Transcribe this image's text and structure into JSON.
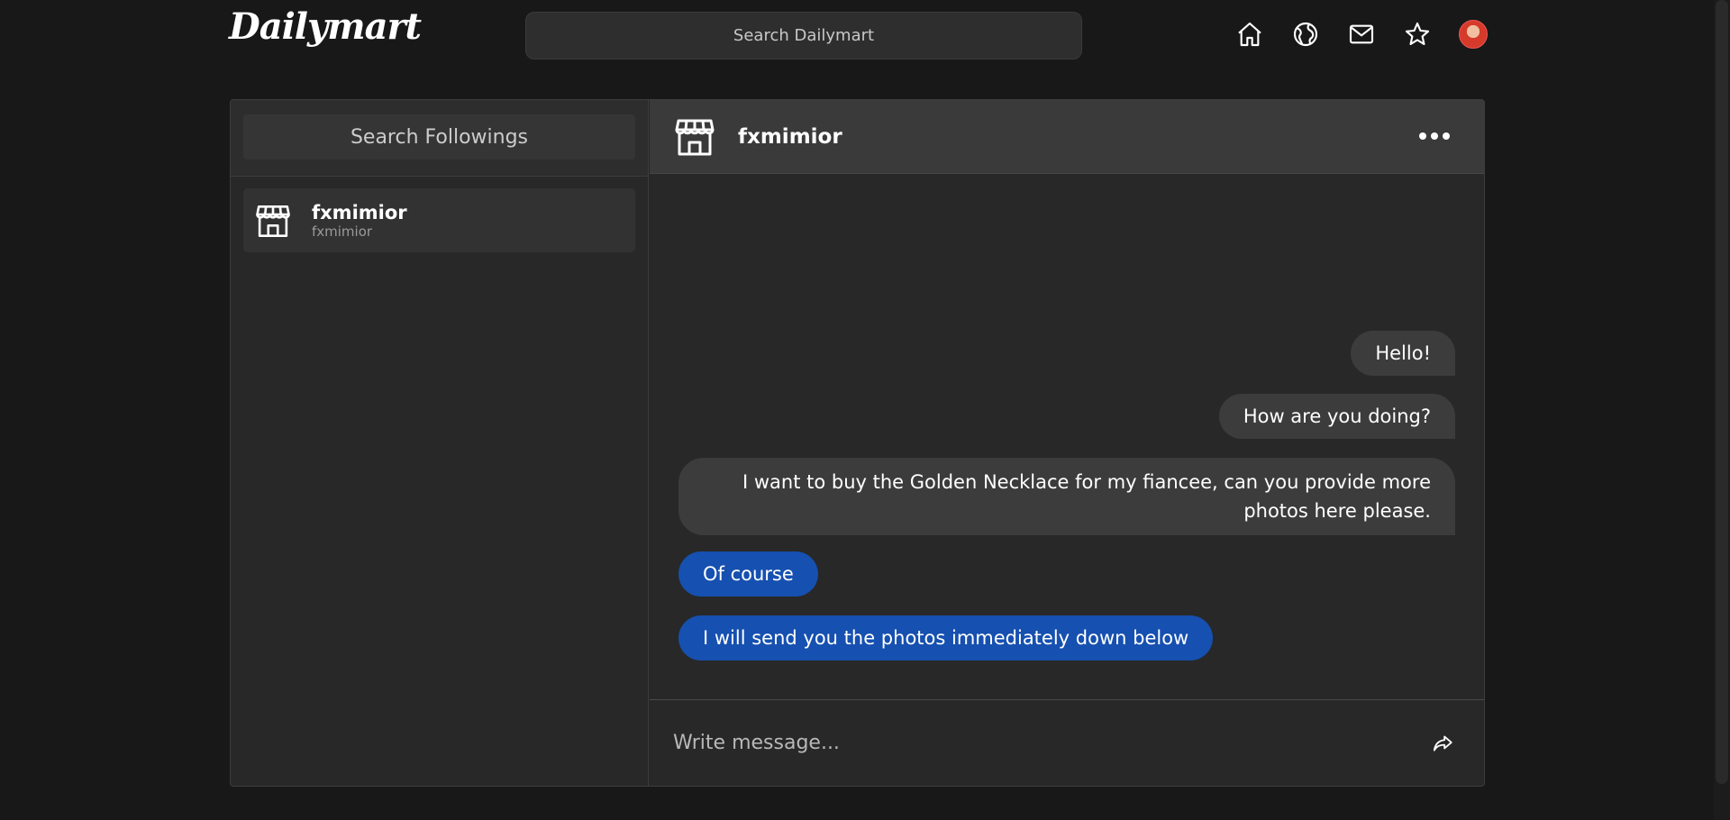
{
  "header": {
    "logo": "Dailymart",
    "search_placeholder": "Search Dailymart",
    "nav": [
      {
        "name": "home-icon"
      },
      {
        "name": "globe-icon"
      },
      {
        "name": "mail-icon"
      },
      {
        "name": "star-icon"
      },
      {
        "name": "avatar"
      }
    ]
  },
  "sidebar": {
    "search_placeholder": "Search Followings",
    "contacts": [
      {
        "name": "fxmimior",
        "handle": "fxmimior",
        "icon": "store-icon"
      }
    ]
  },
  "chat": {
    "title": "fxmimior",
    "icon": "store-icon",
    "more_icon": "more-horizontal-icon",
    "messages": [
      {
        "text": "Hello!",
        "direction": "outgoing"
      },
      {
        "text": "How are you doing?",
        "direction": "outgoing"
      },
      {
        "text": "I want to buy the Golden Necklace for my fiancee, can you provide more photos here please.",
        "direction": "outgoing"
      },
      {
        "text": "Of course",
        "direction": "incoming"
      },
      {
        "text": "I will send you the photos immediately down below",
        "direction": "incoming"
      }
    ],
    "composer_placeholder": "Write message...",
    "send_icon": "share-arrow-icon"
  },
  "colors": {
    "background": "#181818",
    "panel": "#272727",
    "header": "#3a3a3a",
    "outgoing_bubble": "#3c3c3c",
    "incoming_bubble": "#1650b0"
  }
}
